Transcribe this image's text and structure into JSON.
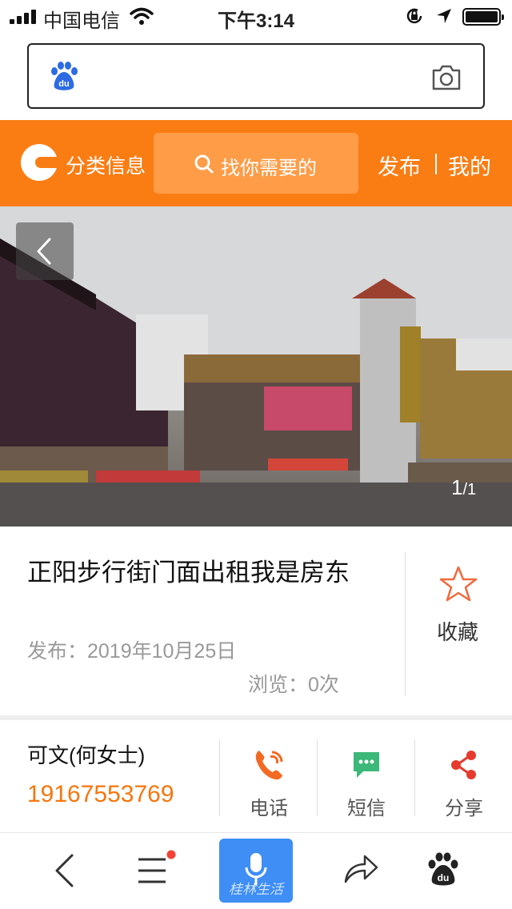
{
  "status_bar": {
    "carrier": "中国电信",
    "time": "下午3:14"
  },
  "header": {
    "category_label": "分类信息",
    "search_placeholder": "找你需要的",
    "publish": "发布",
    "mine": "我的"
  },
  "gallery": {
    "current": "1",
    "total": "/1"
  },
  "listing": {
    "title": "正阳步行街门面出租我是房东",
    "publish_date": "发布：2019年10月25日",
    "views": "浏览：0次",
    "favorite_label": "收藏"
  },
  "contact": {
    "name": "可文(何女士)",
    "phone": "19167553769",
    "actions": [
      "电话",
      "短信",
      "分享"
    ]
  },
  "bottom_bar": {
    "watermark": "桂林生活"
  },
  "colors": {
    "brand_orange": "#fa7d14",
    "phone_orange": "#f7760d",
    "sms_green": "#3cb878",
    "mic_blue": "#3e8ef5",
    "notification_red": "#f44336"
  },
  "icons": [
    "signal-icon",
    "wifi-icon",
    "rotation-lock-icon",
    "location-icon",
    "battery-icon",
    "baidu-paw-icon",
    "camera-icon",
    "search-icon",
    "back-chevron-icon",
    "star-icon",
    "phone-icon",
    "sms-icon",
    "share-icon",
    "menu-icon",
    "microphone-icon",
    "forward-icon"
  ]
}
